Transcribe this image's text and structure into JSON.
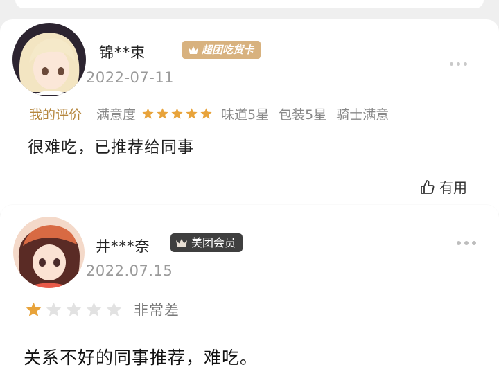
{
  "review1": {
    "username": "锦**束",
    "date": "2022-07-11",
    "badge": "超团吃货卡",
    "my_eval_label": "我的评价",
    "satisfaction_label": "满意度",
    "stars": 5,
    "taste": "味道5星",
    "packaging": "包装5星",
    "rider": "骑士满意",
    "comment": "很难吃，已推荐给同事",
    "helpful_label": "有用"
  },
  "review2": {
    "username": "井***奈",
    "date": "2022.07.15",
    "badge": "美团会员",
    "stars": 1,
    "rating_label": "非常差",
    "comment": "关系不好的同事推荐，难吃。"
  },
  "colors": {
    "gold": "#e8a33a",
    "gold_badge": "#d8b27f",
    "dark_badge": "#3f3f3f",
    "star_empty": "#e2e2e2"
  }
}
